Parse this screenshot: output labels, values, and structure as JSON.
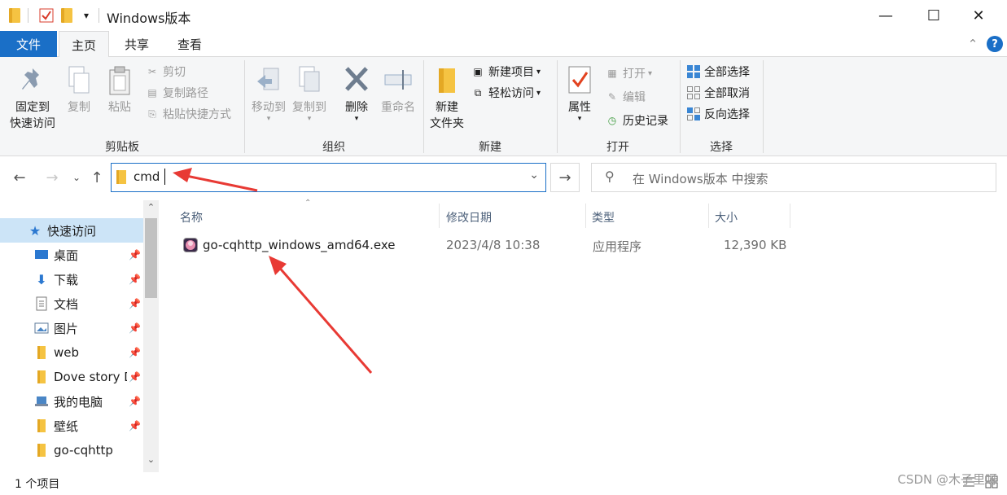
{
  "window": {
    "title": "Windows版本",
    "qa_dropdown": "▾",
    "minimize": "—",
    "maximize": "☐",
    "close": "✕"
  },
  "tabs": {
    "file": "文件",
    "home": "主页",
    "share": "共享",
    "view": "查看",
    "collapse": "⌃",
    "help": "?"
  },
  "ribbon": {
    "clipboard": {
      "pin_line1": "固定到",
      "pin_line2": "快速访问",
      "copy": "复制",
      "paste": "粘贴",
      "cut": "剪切",
      "copy_path": "复制路径",
      "paste_shortcut": "粘贴快捷方式",
      "label": "剪贴板"
    },
    "organize": {
      "move_to": "移动到",
      "copy_to": "复制到",
      "delete": "删除",
      "rename": "重命名",
      "label": "组织"
    },
    "new": {
      "new_folder_line1": "新建",
      "new_folder_line2": "文件夹",
      "new_item": "新建项目",
      "easy_access": "轻松访问",
      "label": "新建"
    },
    "open": {
      "properties": "属性",
      "open": "打开",
      "edit": "编辑",
      "history": "历史记录",
      "label": "打开"
    },
    "select": {
      "select_all": "全部选择",
      "select_none": "全部取消",
      "invert": "反向选择",
      "label": "选择"
    }
  },
  "address": {
    "value": "cmd",
    "search_placeholder": "在 Windows版本 中搜索"
  },
  "sidebar": {
    "items": [
      {
        "label": "快速访问",
        "pinned": false
      },
      {
        "label": "桌面",
        "pinned": true
      },
      {
        "label": "下载",
        "pinned": true
      },
      {
        "label": "文档",
        "pinned": true
      },
      {
        "label": "图片",
        "pinned": true
      },
      {
        "label": "web",
        "pinned": true
      },
      {
        "label": "Dove story D",
        "pinned": true
      },
      {
        "label": "我的电脑",
        "pinned": true
      },
      {
        "label": "壁纸",
        "pinned": true
      },
      {
        "label": "go-cqhttp",
        "pinned": false
      }
    ]
  },
  "columns": {
    "name": "名称",
    "modified": "修改日期",
    "type": "类型",
    "size": "大小"
  },
  "files": [
    {
      "name": "go-cqhttp_windows_amd64.exe",
      "modified": "2023/4/8 10:38",
      "type": "应用程序",
      "size": "12,390 KB"
    }
  ],
  "status": {
    "count": "1 个项目"
  },
  "watermark": "CSDN @木子里呀",
  "colors": {
    "accent": "#1a6fc7",
    "arrow": "#e83a34",
    "folder": "#f5c342"
  }
}
